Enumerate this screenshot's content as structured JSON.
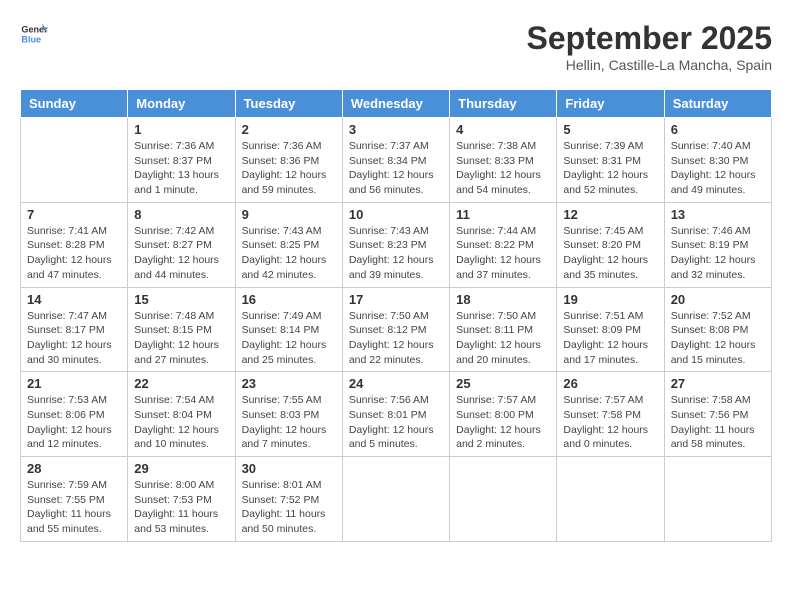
{
  "logo": {
    "text_general": "General",
    "text_blue": "Blue"
  },
  "title": "September 2025",
  "subtitle": "Hellin, Castille-La Mancha, Spain",
  "days_of_week": [
    "Sunday",
    "Monday",
    "Tuesday",
    "Wednesday",
    "Thursday",
    "Friday",
    "Saturday"
  ],
  "weeks": [
    [
      {
        "day": "",
        "info": ""
      },
      {
        "day": "1",
        "info": "Sunrise: 7:36 AM\nSunset: 8:37 PM\nDaylight: 13 hours\nand 1 minute."
      },
      {
        "day": "2",
        "info": "Sunrise: 7:36 AM\nSunset: 8:36 PM\nDaylight: 12 hours\nand 59 minutes."
      },
      {
        "day": "3",
        "info": "Sunrise: 7:37 AM\nSunset: 8:34 PM\nDaylight: 12 hours\nand 56 minutes."
      },
      {
        "day": "4",
        "info": "Sunrise: 7:38 AM\nSunset: 8:33 PM\nDaylight: 12 hours\nand 54 minutes."
      },
      {
        "day": "5",
        "info": "Sunrise: 7:39 AM\nSunset: 8:31 PM\nDaylight: 12 hours\nand 52 minutes."
      },
      {
        "day": "6",
        "info": "Sunrise: 7:40 AM\nSunset: 8:30 PM\nDaylight: 12 hours\nand 49 minutes."
      }
    ],
    [
      {
        "day": "7",
        "info": "Sunrise: 7:41 AM\nSunset: 8:28 PM\nDaylight: 12 hours\nand 47 minutes."
      },
      {
        "day": "8",
        "info": "Sunrise: 7:42 AM\nSunset: 8:27 PM\nDaylight: 12 hours\nand 44 minutes."
      },
      {
        "day": "9",
        "info": "Sunrise: 7:43 AM\nSunset: 8:25 PM\nDaylight: 12 hours\nand 42 minutes."
      },
      {
        "day": "10",
        "info": "Sunrise: 7:43 AM\nSunset: 8:23 PM\nDaylight: 12 hours\nand 39 minutes."
      },
      {
        "day": "11",
        "info": "Sunrise: 7:44 AM\nSunset: 8:22 PM\nDaylight: 12 hours\nand 37 minutes."
      },
      {
        "day": "12",
        "info": "Sunrise: 7:45 AM\nSunset: 8:20 PM\nDaylight: 12 hours\nand 35 minutes."
      },
      {
        "day": "13",
        "info": "Sunrise: 7:46 AM\nSunset: 8:19 PM\nDaylight: 12 hours\nand 32 minutes."
      }
    ],
    [
      {
        "day": "14",
        "info": "Sunrise: 7:47 AM\nSunset: 8:17 PM\nDaylight: 12 hours\nand 30 minutes."
      },
      {
        "day": "15",
        "info": "Sunrise: 7:48 AM\nSunset: 8:15 PM\nDaylight: 12 hours\nand 27 minutes."
      },
      {
        "day": "16",
        "info": "Sunrise: 7:49 AM\nSunset: 8:14 PM\nDaylight: 12 hours\nand 25 minutes."
      },
      {
        "day": "17",
        "info": "Sunrise: 7:50 AM\nSunset: 8:12 PM\nDaylight: 12 hours\nand 22 minutes."
      },
      {
        "day": "18",
        "info": "Sunrise: 7:50 AM\nSunset: 8:11 PM\nDaylight: 12 hours\nand 20 minutes."
      },
      {
        "day": "19",
        "info": "Sunrise: 7:51 AM\nSunset: 8:09 PM\nDaylight: 12 hours\nand 17 minutes."
      },
      {
        "day": "20",
        "info": "Sunrise: 7:52 AM\nSunset: 8:08 PM\nDaylight: 12 hours\nand 15 minutes."
      }
    ],
    [
      {
        "day": "21",
        "info": "Sunrise: 7:53 AM\nSunset: 8:06 PM\nDaylight: 12 hours\nand 12 minutes."
      },
      {
        "day": "22",
        "info": "Sunrise: 7:54 AM\nSunset: 8:04 PM\nDaylight: 12 hours\nand 10 minutes."
      },
      {
        "day": "23",
        "info": "Sunrise: 7:55 AM\nSunset: 8:03 PM\nDaylight: 12 hours\nand 7 minutes."
      },
      {
        "day": "24",
        "info": "Sunrise: 7:56 AM\nSunset: 8:01 PM\nDaylight: 12 hours\nand 5 minutes."
      },
      {
        "day": "25",
        "info": "Sunrise: 7:57 AM\nSunset: 8:00 PM\nDaylight: 12 hours\nand 2 minutes."
      },
      {
        "day": "26",
        "info": "Sunrise: 7:57 AM\nSunset: 7:58 PM\nDaylight: 12 hours\nand 0 minutes."
      },
      {
        "day": "27",
        "info": "Sunrise: 7:58 AM\nSunset: 7:56 PM\nDaylight: 11 hours\nand 58 minutes."
      }
    ],
    [
      {
        "day": "28",
        "info": "Sunrise: 7:59 AM\nSunset: 7:55 PM\nDaylight: 11 hours\nand 55 minutes."
      },
      {
        "day": "29",
        "info": "Sunrise: 8:00 AM\nSunset: 7:53 PM\nDaylight: 11 hours\nand 53 minutes."
      },
      {
        "day": "30",
        "info": "Sunrise: 8:01 AM\nSunset: 7:52 PM\nDaylight: 11 hours\nand 50 minutes."
      },
      {
        "day": "",
        "info": ""
      },
      {
        "day": "",
        "info": ""
      },
      {
        "day": "",
        "info": ""
      },
      {
        "day": "",
        "info": ""
      }
    ]
  ]
}
